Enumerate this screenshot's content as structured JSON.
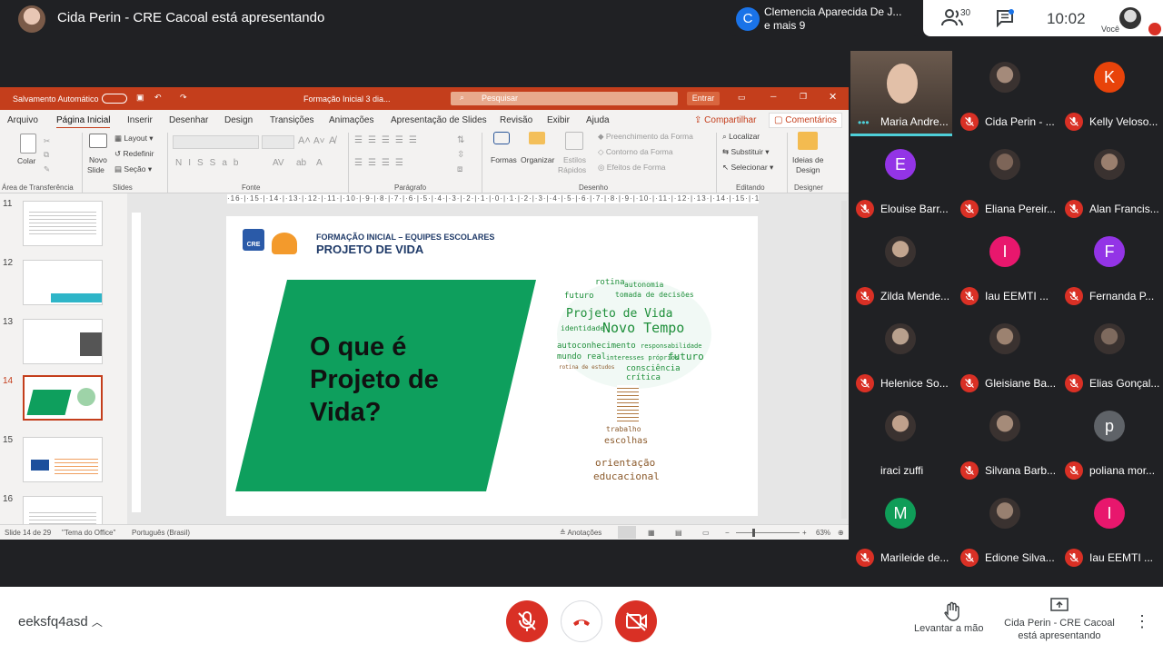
{
  "meet": {
    "presenter_title": "Cida Perin - CRE Cacoal está apresentando",
    "speaking_initial": "C",
    "speaking_name": "Clemencia Aparecida De J...",
    "speaking_more": "e mais 9",
    "people_count": "30",
    "time": "10:02",
    "self_label": "Você",
    "meeting_code": "eeksfq4asd",
    "raise_hand_label": "Levantar a mão",
    "presenting_label": "Cida Perin - CRE Cacoal está apresentando",
    "accent": "#1a73e8",
    "danger": "#d93025"
  },
  "ppt": {
    "autosave": "Salvamento Automático",
    "filename": "Formação Inicial 3 dia...",
    "search_placeholder": "Pesquisar",
    "enter": "Entrar",
    "tabs": [
      "Arquivo",
      "Página Inicial",
      "Inserir",
      "Desenhar",
      "Design",
      "Transições",
      "Animações",
      "Apresentação de Slides",
      "Revisão",
      "Exibir",
      "Ajuda"
    ],
    "share": "Compartilhar",
    "comments": "Comentários",
    "ribbon": {
      "colar": "Colar",
      "novo_slide_1": "Novo",
      "novo_slide_2": "Slide",
      "layout": "Layout",
      "redefinir": "Redefinir",
      "secao": "Seção",
      "formas": "Formas",
      "organizar": "Organizar",
      "estilos_1": "Estilos",
      "estilos_2": "Rápidos",
      "preenchimento": "Preenchimento da Forma",
      "contorno": "Contorno da Forma",
      "efeitos": "Efeitos de Forma",
      "localizar": "Localizar",
      "substituir": "Substituir",
      "selecionar": "Selecionar",
      "ideias_1": "Ideias de",
      "ideias_2": "Design",
      "groups": {
        "clip": "Área de Transferência",
        "slides": "Slides",
        "fonte": "Fonte",
        "paragrafo": "Parágrafo",
        "desenho": "Desenho",
        "editando": "Editando",
        "designer": "Designer"
      }
    },
    "ruler": "·16·|·15·|·14·|·13·|·12·|·11·|·10·|·9·|·8·|·7·|·6·|·5·|·4·|·3·|·2·|·1·|·0·|·1·|·2·|·3·|·4·|·5·|·6·|·7·|·8·|·9·|·10·|·11·|·12·|·13·|·14·|·15·|·16·",
    "thumb_numbers": [
      "11",
      "12",
      "13",
      "14",
      "15",
      "16"
    ],
    "status": {
      "slide": "Slide 14 de 29",
      "theme": "\"Tema do Office\"",
      "language": "Português (Brasil)",
      "notes": "Anotações",
      "zoom": "63%"
    },
    "slide": {
      "header_small": "FORMAÇÃO INICIAL – EQUIPES ESCOLARES",
      "header_big": "PROJETO DE VIDA",
      "logo1": "CRE",
      "question_1": "O que é",
      "question_2": "Projeto de",
      "question_3": "Vida?",
      "green": "#0e9f5d",
      "wordcloud": [
        "rotina",
        "autonomia",
        "futuro",
        "tomada de decisões",
        "Projeto de Vida",
        "identidade",
        "Novo Tempo",
        "autoconhecimento",
        "responsabilidade",
        "mundo real",
        "interesses próprios",
        "futuro",
        "consciência crítica",
        "rotina de estudos",
        "trabalho",
        "escolhas",
        "orientação",
        "educacional"
      ]
    }
  },
  "participants": [
    {
      "name": "Maria Andre...",
      "initial": "",
      "color": "",
      "photo": true,
      "muted": false
    },
    {
      "name": "Cida Perin - ...",
      "initial": "",
      "color": "",
      "photo": true,
      "muted": true
    },
    {
      "name": "Kelly Veloso...",
      "initial": "K",
      "color": "#e8430a",
      "photo": false,
      "muted": true
    },
    {
      "name": "Elouise Barr...",
      "initial": "E",
      "color": "#9334e6",
      "photo": false,
      "muted": true
    },
    {
      "name": "Eliana Pereir...",
      "initial": "",
      "color": "",
      "photo": true,
      "muted": true
    },
    {
      "name": "Alan Francis...",
      "initial": "",
      "color": "",
      "photo": true,
      "muted": true
    },
    {
      "name": "Zilda Mende...",
      "initial": "",
      "color": "",
      "photo": true,
      "muted": true
    },
    {
      "name": "Iau EEMTI ...",
      "initial": "I",
      "color": "#e8176d",
      "photo": false,
      "muted": true
    },
    {
      "name": "Fernanda P...",
      "initial": "F",
      "color": "#9334e6",
      "photo": false,
      "muted": true
    },
    {
      "name": "Helenice So...",
      "initial": "",
      "color": "",
      "photo": true,
      "muted": true
    },
    {
      "name": "Gleisiane Ba...",
      "initial": "",
      "color": "",
      "photo": true,
      "muted": true
    },
    {
      "name": "Elias Gonçal...",
      "initial": "",
      "color": "",
      "photo": true,
      "muted": true
    },
    {
      "name": "iraci zuffi",
      "initial": "",
      "color": "",
      "photo": true,
      "muted": false
    },
    {
      "name": "Silvana Barb...",
      "initial": "",
      "color": "",
      "photo": true,
      "muted": true
    },
    {
      "name": "poliana mor...",
      "initial": "p",
      "color": "#5f6368",
      "photo": false,
      "muted": true
    },
    {
      "name": "Marileide de...",
      "initial": "M",
      "color": "#0f9d58",
      "photo": false,
      "muted": true
    },
    {
      "name": "Edione Silva...",
      "initial": "",
      "color": "",
      "photo": true,
      "muted": true
    },
    {
      "name": "Iau EEMTI ...",
      "initial": "I",
      "color": "#e8176d",
      "photo": false,
      "muted": true
    }
  ]
}
